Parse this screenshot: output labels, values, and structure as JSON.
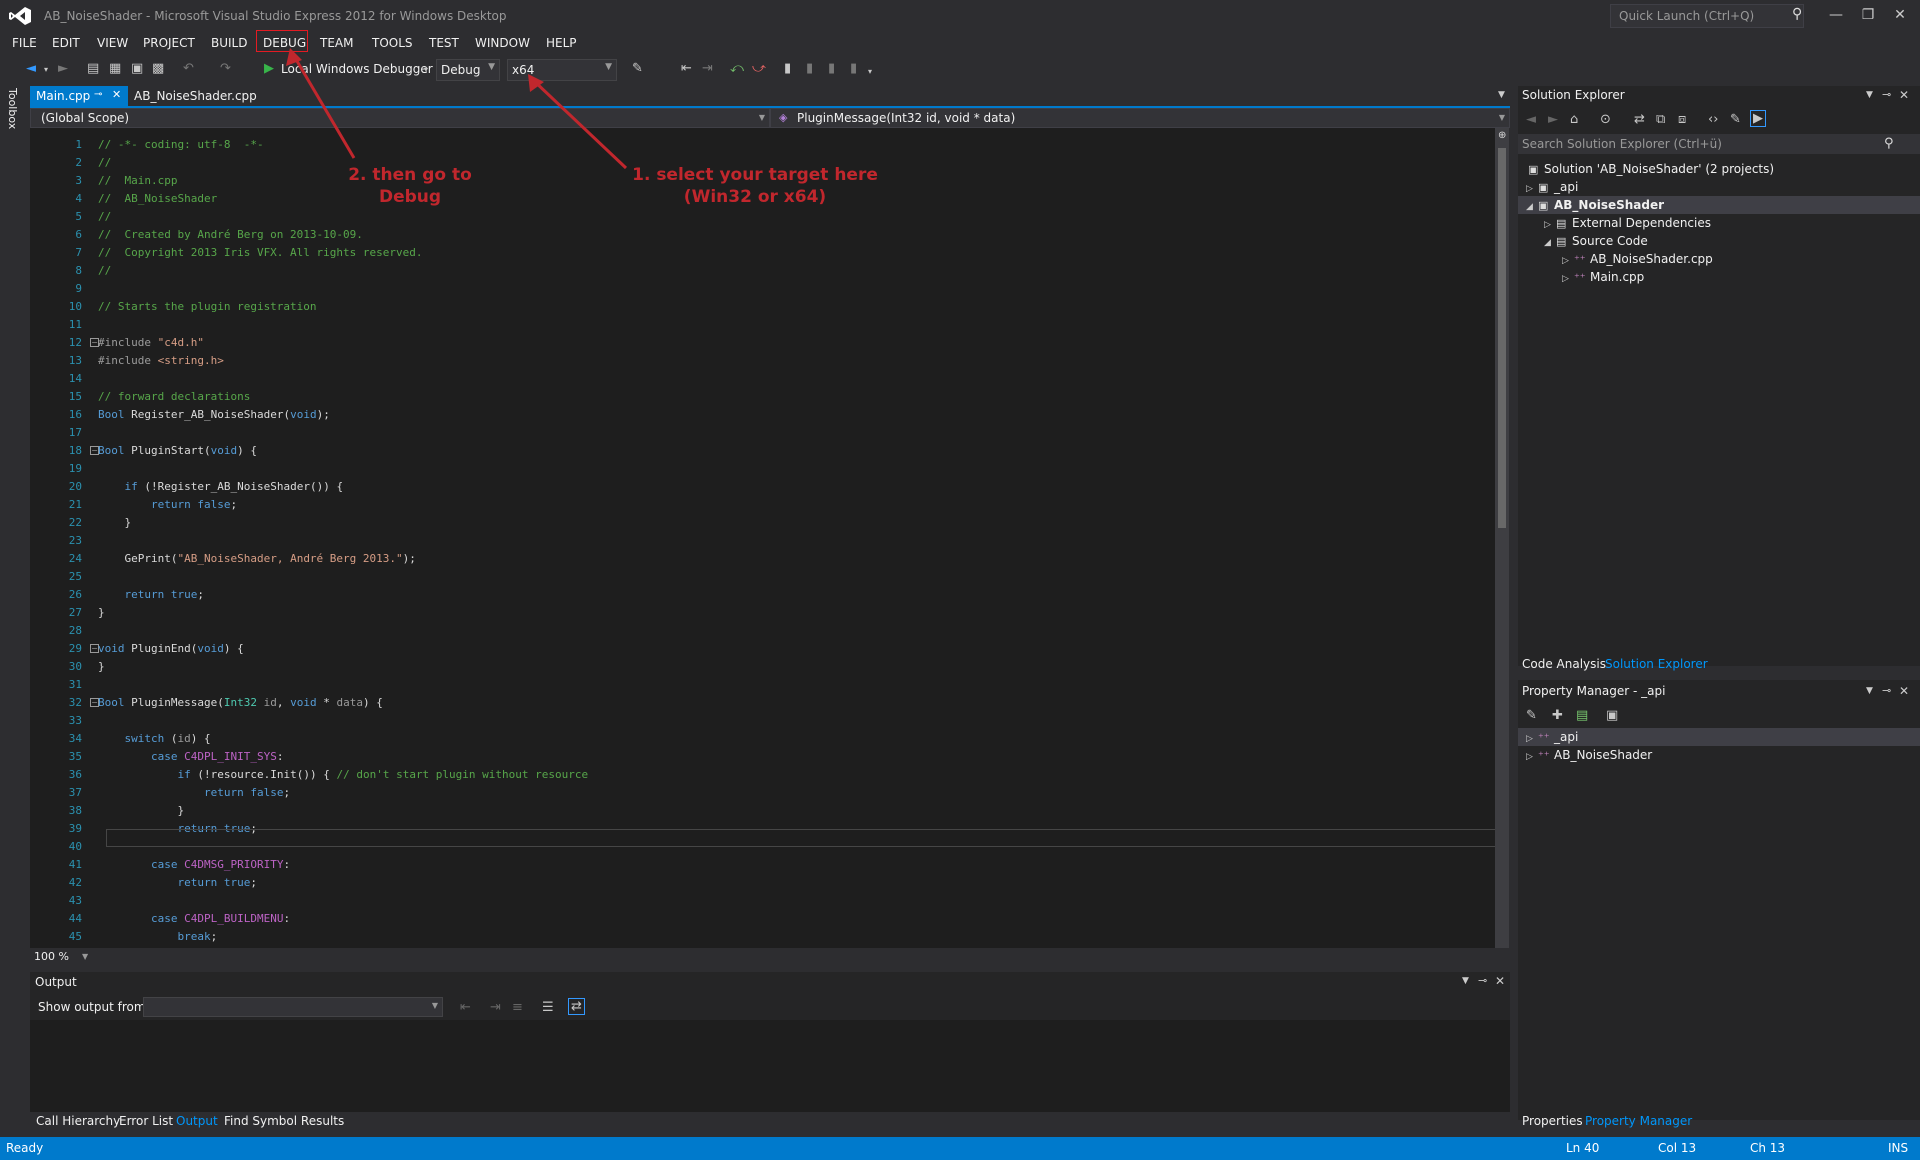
{
  "window": {
    "title": "AB_NoiseShader - Microsoft Visual Studio Express 2012 for Windows Desktop",
    "quick_launch_placeholder": "Quick Launch (Ctrl+Q)"
  },
  "menu": [
    "FILE",
    "EDIT",
    "VIEW",
    "PROJECT",
    "BUILD",
    "DEBUG",
    "TEAM",
    "TOOLS",
    "TEST",
    "WINDOW",
    "HELP"
  ],
  "toolbar": {
    "debugger_label": "Local Windows Debugger",
    "config": "Debug",
    "platform": "x64"
  },
  "toolbox_label": "Toolbox",
  "tabs": [
    "Main.cpp",
    "AB_NoiseShader.cpp"
  ],
  "nav": {
    "scope": "(Global Scope)",
    "member": "PluginMessage(Int32 id, void * data)"
  },
  "annotations": {
    "a1": "1. select your target here",
    "a1b": "(Win32 or x64)",
    "a2": "2. then go to",
    "a2b": "Debug"
  },
  "code_lines": [
    "// -*- coding: utf-8  -*-",
    "//",
    "//  Main.cpp",
    "//  AB_NoiseShader",
    "//",
    "//  Created by André Berg on 2013-10-09.",
    "//  Copyright 2013 Iris VFX. All rights reserved.",
    "//",
    "",
    "// Starts the plugin registration",
    "",
    "#include \"c4d.h\"",
    "#include <string.h>",
    "",
    "// forward declarations",
    "Bool Register_AB_NoiseShader(void);",
    "",
    "Bool PluginStart(void) {",
    "",
    "    if (!Register_AB_NoiseShader()) {",
    "        return false;",
    "    }",
    "",
    "    GePrint(\"AB_NoiseShader, André Berg 2013.\");",
    "",
    "    return true;",
    "}",
    "",
    "void PluginEnd(void) {",
    "}",
    "",
    "Bool PluginMessage(Int32 id, void * data) {",
    "",
    "    switch (id) {",
    "        case C4DPL_INIT_SYS:",
    "            if (!resource.Init()) { // don't start plugin without resource",
    "                return false;",
    "            }",
    "            return true;",
    "",
    "        case C4DMSG_PRIORITY:",
    "            return true;",
    "",
    "        case C4DPL_BUILDMENU:",
    "            break;",
    ""
  ],
  "zoom": "100 %",
  "output": {
    "title": "Output",
    "show_from_label": "Show output from:"
  },
  "bottom_tabs": [
    "Call Hierarchy",
    "Error List",
    "Output",
    "Find Symbol Results"
  ],
  "solution_explorer": {
    "title": "Solution Explorer",
    "search_placeholder": "Search Solution Explorer (Ctrl+ü)",
    "items": [
      "Solution 'AB_NoiseShader' (2 projects)",
      "_api",
      "AB_NoiseShader",
      "External Dependencies",
      "Source Code",
      "AB_NoiseShader.cpp",
      "Main.cpp"
    ]
  },
  "right_tabs": [
    "Code Analysis",
    "Solution Explorer"
  ],
  "property_manager": {
    "title": "Property Manager - _api",
    "items": [
      "_api",
      "AB_NoiseShader"
    ]
  },
  "right_bottom_tabs": [
    "Properties",
    "Property Manager"
  ],
  "status": {
    "ready": "Ready",
    "ln": "Ln 40",
    "col": "Col 13",
    "ch": "Ch 13",
    "ins": "INS"
  },
  "colors": {
    "accent": "#007acc",
    "annotation": "#c1272d"
  }
}
